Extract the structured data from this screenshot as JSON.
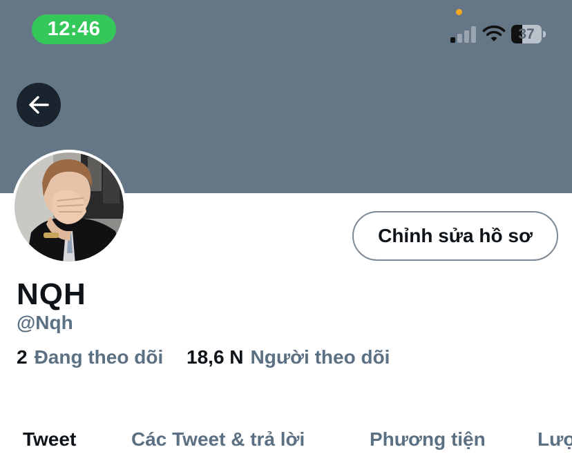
{
  "status_bar": {
    "time": "12:46",
    "battery_level": "37",
    "battery_fraction": 0.37,
    "signal_bars_active": 1,
    "signal_bars_total": 4,
    "accent_time_color": "#34c759",
    "privacy_dot_color": "#f5a623"
  },
  "header": {
    "banner_color": "#657786",
    "back_icon": "arrow-left-icon"
  },
  "profile": {
    "display_name": "NQH",
    "handle": "@Nqh",
    "edit_button_label": "Chỉnh sửa hồ sơ",
    "following_count": "2",
    "following_label": "Đang theo dõi",
    "followers_count": "18,6 N",
    "followers_label": "Người theo dõi"
  },
  "tabs": [
    {
      "label": "Tweet",
      "active": true
    },
    {
      "label": "Các Tweet & trả lời",
      "active": false
    },
    {
      "label": "Phương tiện",
      "active": false
    },
    {
      "label": "Lượt thích",
      "active": false
    }
  ]
}
